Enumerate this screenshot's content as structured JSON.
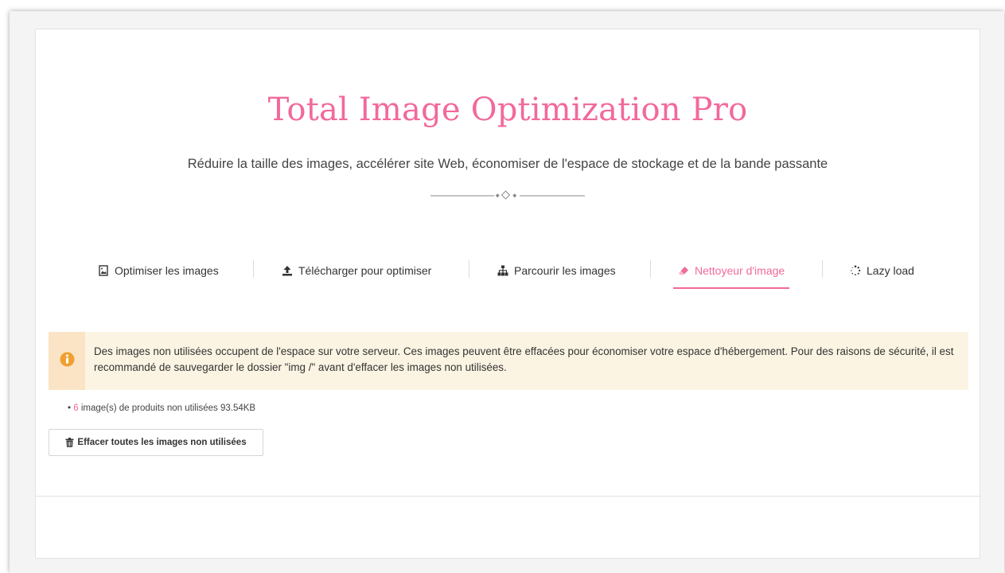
{
  "header": {
    "title": "Total Image Optimization Pro",
    "subtitle": "Réduire la taille des images, accélérer site Web, économiser de l'espace de stockage et de la bande passante"
  },
  "tabs": [
    {
      "label": "Optimiser les images",
      "icon": "image-file-icon",
      "active": false
    },
    {
      "label": "Télécharger pour optimiser",
      "icon": "upload-icon",
      "active": false
    },
    {
      "label": "Parcourir les images",
      "icon": "sitemap-icon",
      "active": false
    },
    {
      "label": "Nettoyeur d'image",
      "icon": "eraser-icon",
      "active": true
    },
    {
      "label": "Lazy load",
      "icon": "spinner-icon",
      "active": false
    }
  ],
  "alert": {
    "icon": "info-icon",
    "text": "Des images non utilisées occupent de l'espace sur votre serveur. Ces images peuvent être effacées pour économiser votre espace d'hébergement. Pour des raisons de sécurité, il est recommandé de sauvegarder le dossier \"img /\" avant d'effacer les images non utilisées."
  },
  "stats": {
    "count": "6",
    "text": "image(s) de produits non utilisées 93.54KB"
  },
  "actions": {
    "delete_label": "Effacer toutes les images non utilisées",
    "delete_icon": "trash-icon"
  },
  "colors": {
    "accent": "#f2699c",
    "alert_bg": "#fcf4e3",
    "alert_side": "#fbe4c6",
    "info_icon": "#f0a030"
  }
}
